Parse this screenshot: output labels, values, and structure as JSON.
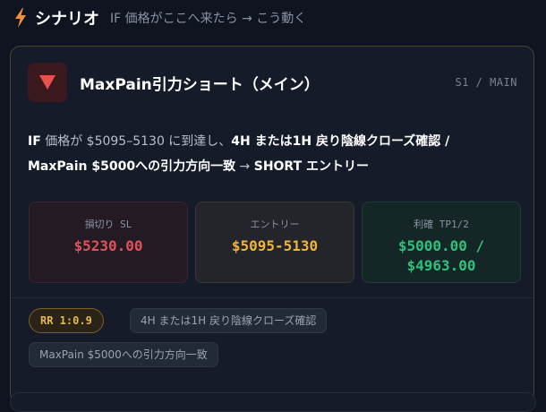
{
  "header": {
    "icon": "lightning-bolt-icon",
    "title": "シナリオ",
    "subtitle": "IF 価格がここへ来たら → こう動く"
  },
  "scenario": {
    "direction_icon": "down-triangle-icon",
    "title": "MaxPain引力ショート（メイン）",
    "id": "S1 / MAIN",
    "condition": {
      "p1": "IF",
      "p2": " 価格が $5095–5130 に到達し、",
      "p3": "4H または1H 戻り陰線クローズ確認 / MaxPain $5000への引力方向一致",
      "p4": " → ",
      "p5": "SHORT エントリー"
    },
    "metrics": {
      "sl_label": "損切り SL",
      "sl_value": "$5230.00",
      "entry_label": "エントリー",
      "entry_value": "$5095-5130",
      "tp_label": "利確 TP1/2",
      "tp_value1": "$5000.00 /",
      "tp_value2": "$4963.00"
    },
    "tags": {
      "rr": "RR 1:0.9",
      "t1": "4H または1H 戻り陰線クローズ確認",
      "t2": "MaxPain $5000への引力方向一致"
    }
  },
  "colors": {
    "accent_orange": "#f0913a",
    "short_red": "#e8504a",
    "sl_red": "#e0525a",
    "entry_amber": "#f0b43c",
    "tp_green": "#2fc07e"
  }
}
